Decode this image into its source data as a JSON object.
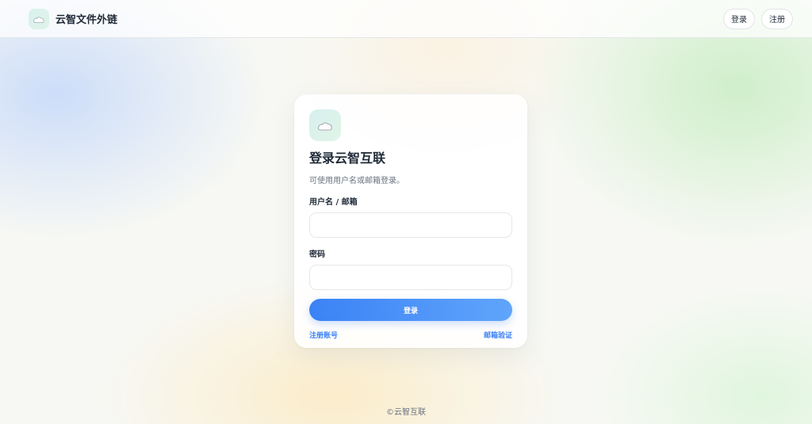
{
  "header": {
    "brand_name": "云智文件外链",
    "brand_icon": "cloud-icon",
    "login_label": "登录",
    "register_label": "注册"
  },
  "card": {
    "icon": "cloud-icon",
    "title": "登录云智互联",
    "subtitle": "可使用用户名或邮箱登录。",
    "username_label": "用户名 / 邮箱",
    "username_value": "",
    "password_label": "密码",
    "password_value": "",
    "submit_label": "登录",
    "register_link": "注册账号",
    "verify_link": "邮箱验证"
  },
  "footer": {
    "copyright": "©云智互联"
  },
  "colors": {
    "accent": "#3b82f6",
    "accent_light": "#60a5fa",
    "text": "#1f2937",
    "muted": "#6b7280"
  }
}
